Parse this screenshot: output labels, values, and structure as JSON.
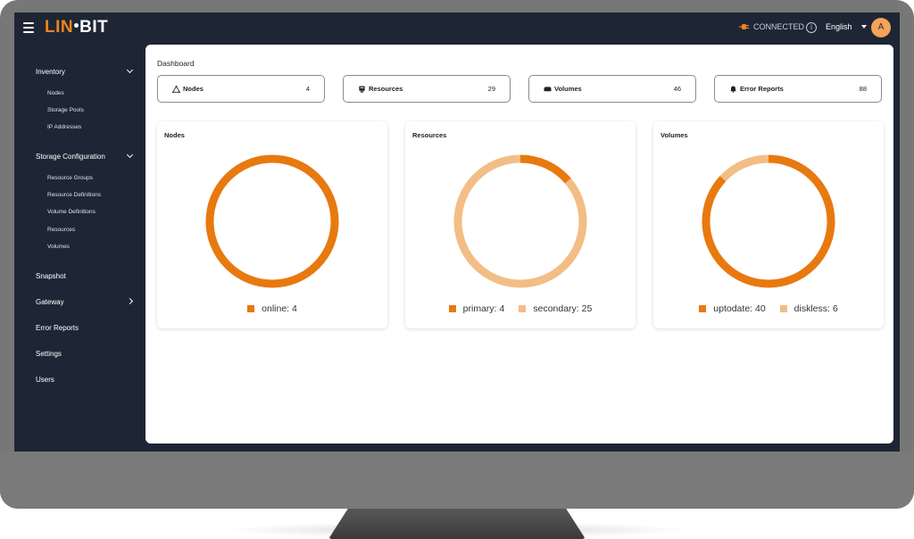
{
  "app": {
    "logo_left": "LIN",
    "logo_right": "BIT",
    "connection_status": "CONNECTED",
    "language": "English",
    "user_initial": "A"
  },
  "colors": {
    "accent": "#e8790f",
    "accent_light": "#f3bd86",
    "sidebar_bg": "#1e2635"
  },
  "sidebar": {
    "inventory": {
      "label": "Inventory",
      "items": [
        "Nodes",
        "Storage Pools",
        "IP Addresses"
      ]
    },
    "storage_configuration": {
      "label": "Storage Configuration",
      "items": [
        "Resource Groups",
        "Resource Definitions",
        "Volume Definitions",
        "Resources",
        "Volumes"
      ]
    },
    "snapshot": "Snapshot",
    "gateway": "Gateway",
    "error_reports": "Error Reports",
    "settings": "Settings",
    "users": "Users"
  },
  "dashboard": {
    "title": "Dashboard",
    "stats": [
      {
        "label": "Nodes",
        "value": "4",
        "icon": "nodes-icon"
      },
      {
        "label": "Resources",
        "value": "29",
        "icon": "resource-icon"
      },
      {
        "label": "Volumes",
        "value": "46",
        "icon": "volume-icon"
      },
      {
        "label": "Error Reports",
        "value": "88",
        "icon": "bell-icon"
      }
    ]
  },
  "chart_data": [
    {
      "type": "pie",
      "title": "Nodes",
      "categories": [
        "online"
      ],
      "values": [
        4
      ],
      "legend_labels": [
        "online: 4"
      ],
      "colors": [
        "#e8790f"
      ]
    },
    {
      "type": "pie",
      "title": "Resources",
      "categories": [
        "primary",
        "secondary"
      ],
      "values": [
        4,
        25
      ],
      "legend_labels": [
        "primary: 4",
        "secondary: 25"
      ],
      "colors": [
        "#e8790f",
        "#f3bd86"
      ]
    },
    {
      "type": "pie",
      "title": "Volumes",
      "categories": [
        "uptodate",
        "diskless"
      ],
      "values": [
        40,
        6
      ],
      "legend_labels": [
        "uptodate: 40",
        "diskless: 6"
      ],
      "colors": [
        "#e8790f",
        "#f3bd86"
      ]
    }
  ]
}
